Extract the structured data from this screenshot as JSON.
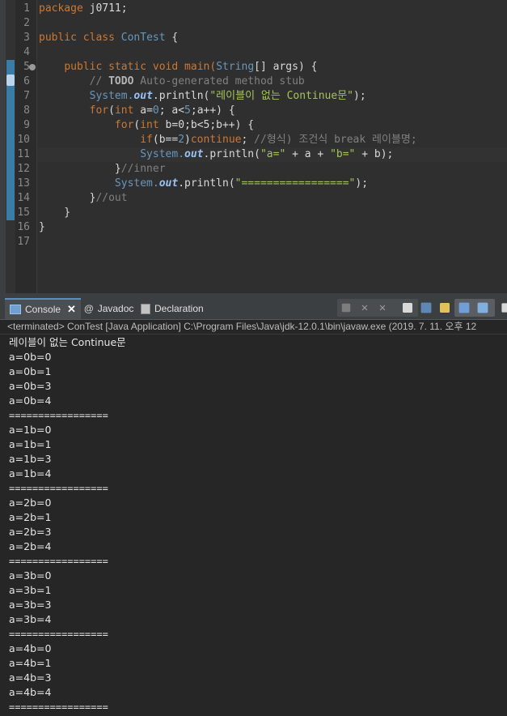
{
  "editor": {
    "line_numbers": [
      "1",
      "2",
      "3",
      "4",
      "5",
      "6",
      "7",
      "8",
      "9",
      "10",
      "11",
      "12",
      "13",
      "14",
      "15",
      "16",
      "17"
    ],
    "code": {
      "l1_kw": "package",
      "l1_rest": " j0711;",
      "l3_kw1": "public",
      "l3_kw2": "class",
      "l3_cls": "ConTest",
      "l3_rest": " {",
      "l5_ind": "    ",
      "l5_kw1": "public",
      "l5_kw2": "static",
      "l5_kw3": "void",
      "l5_m": "main(",
      "l5_t": "String",
      "l5_a": "[] args) {",
      "l6_ind": "        ",
      "l6_c1": "// ",
      "l6_todo": "TODO",
      "l6_c2": " Auto-generated method stub",
      "l7_ind": "        ",
      "l7_cls": "System.",
      "l7_fld": "out",
      "l7_m": ".println(",
      "l7_str": "\"레이블이 없는 Continue문\"",
      "l7_end": ");",
      "l8_ind": "        ",
      "l8_kw": "for",
      "l8_a": "(",
      "l8_t": "int",
      "l8_b": " a=",
      "l8_n0": "0",
      "l8_c": "; a<",
      "l8_n5": "5",
      "l8_d": ";a++) {",
      "l9_ind": "            ",
      "l9_kw": "for",
      "l9_a": "(",
      "l9_t": "int",
      "l9_b": " b=0;b<5;b++) {",
      "l10_ind": "                ",
      "l10_kw": "if",
      "l10_a": "(b==",
      "l10_n": "2",
      "l10_b": ")",
      "l10_kw2": "continue",
      "l10_c": "; ",
      "l10_cmt": "//형식) 조건식 break 레이블명;",
      "l11_ind": "                ",
      "l11_cls": "System.",
      "l11_fld": "out",
      "l11_m": ".println(",
      "l11_s1": "\"a=\"",
      "l11_m2": " + a + ",
      "l11_s2": "\"b=\"",
      "l11_m3": " + b);",
      "l12_ind": "            ",
      "l12_a": "}",
      "l12_cmt": "//inner",
      "l13_ind": "            ",
      "l13_cls": "System.",
      "l13_fld": "out",
      "l13_m": ".println(",
      "l13_str": "\"=================\"",
      "l13_end": ");",
      "l14_ind": "        ",
      "l14_a": "}",
      "l14_cmt": "//out",
      "l15": "    }",
      "l16": "}"
    }
  },
  "tabs": {
    "console": "Console",
    "javadoc": "Javadoc",
    "declaration": "Declaration"
  },
  "console": {
    "header": "<terminated> ConTest [Java Application] C:\\Program Files\\Java\\jdk-12.0.1\\bin\\javaw.exe (2019. 7. 11. 오후 12",
    "lines": [
      "레이블이 없는 Continue문",
      "a=0b=0",
      "a=0b=1",
      "a=0b=3",
      "a=0b=4",
      "=================",
      "a=1b=0",
      "a=1b=1",
      "a=1b=3",
      "a=1b=4",
      "=================",
      "a=2b=0",
      "a=2b=1",
      "a=2b=3",
      "a=2b=4",
      "=================",
      "a=3b=0",
      "a=3b=1",
      "a=3b=3",
      "a=3b=4",
      "=================",
      "a=4b=0",
      "a=4b=1",
      "a=4b=3",
      "a=4b=4",
      "================="
    ]
  },
  "colors": {
    "keyword": "#cc7832",
    "string": "#a5c25c",
    "comment": "#808080",
    "class": "#6897bb",
    "background": "#2b2b2b"
  }
}
